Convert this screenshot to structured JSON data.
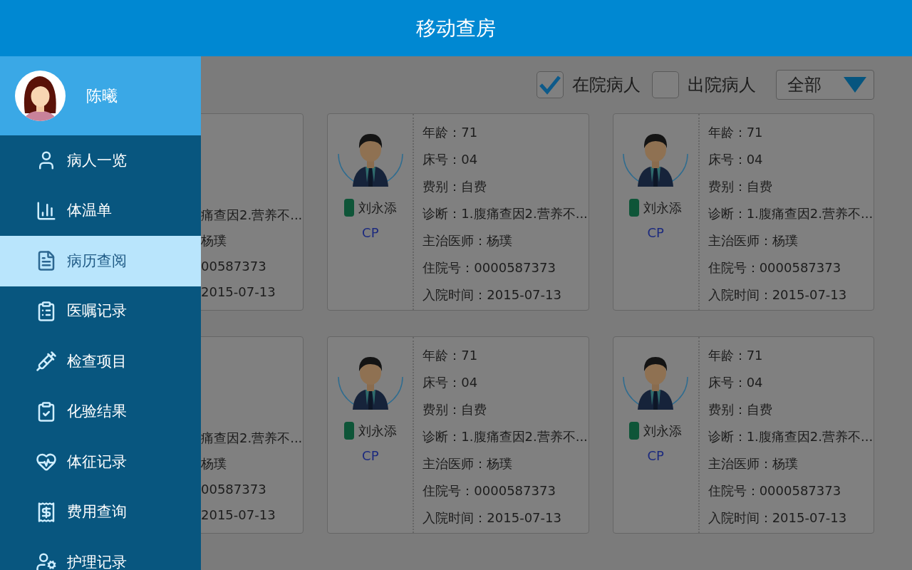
{
  "header": {
    "title": "移动查房"
  },
  "drawer": {
    "user": {
      "name": "陈曦"
    },
    "items": [
      {
        "label": "病人一览",
        "selected": false
      },
      {
        "label": "体温单",
        "selected": false
      },
      {
        "label": "病历查阅",
        "selected": true
      },
      {
        "label": "医嘱记录",
        "selected": false
      },
      {
        "label": "检查项目",
        "selected": false
      },
      {
        "label": "化验结果",
        "selected": false
      },
      {
        "label": "体征记录",
        "selected": false
      },
      {
        "label": "费用查询",
        "selected": false
      },
      {
        "label": "护理记录",
        "selected": false
      }
    ]
  },
  "filters": [
    {
      "label": "在院病人",
      "checked": true
    },
    {
      "label": "出院病人",
      "checked": false
    }
  ],
  "dropdown": {
    "value": "全部"
  },
  "cards": [
    {
      "kind": "partial",
      "fields": [
        "痛查因2.营养不...",
        "杨璞",
        "00587373",
        "2015-07-13"
      ]
    },
    {
      "kind": "full",
      "name": "刘永添",
      "tag": "CP",
      "fields": [
        "年龄：71",
        "床号：04",
        "费别：自费",
        "诊断：1.腹痛查因2.营养不...",
        "主治医师：杨璞",
        "住院号：0000587373",
        "入院时间：2015-07-13"
      ]
    },
    {
      "kind": "full",
      "name": "刘永添",
      "tag": "CP",
      "fields": [
        "年龄：71",
        "床号：04",
        "费别：自费",
        "诊断：1.腹痛查因2.营养不...",
        "主治医师：杨璞",
        "住院号：0000587373",
        "入院时间：2015-07-13"
      ]
    },
    {
      "kind": "partial",
      "fields": [
        "痛查因2.营养不...",
        "杨璞",
        "00587373",
        "2015-07-13"
      ]
    },
    {
      "kind": "full",
      "name": "刘永添",
      "tag": "CP",
      "fields": [
        "年龄：71",
        "床号：04",
        "费别：自费",
        "诊断：1.腹痛查因2.营养不...",
        "主治医师：杨璞",
        "住院号：0000587373",
        "入院时间：2015-07-13"
      ]
    },
    {
      "kind": "full",
      "name": "刘永添",
      "tag": "CP",
      "fields": [
        "年龄：71",
        "床号：04",
        "费别：自费",
        "诊断：1.腹痛查因2.营养不...",
        "主治医师：杨璞",
        "住院号：0000587373",
        "入院时间：2015-07-13"
      ]
    }
  ]
}
